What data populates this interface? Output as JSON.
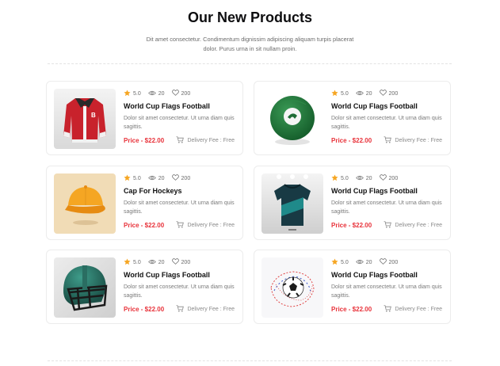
{
  "section": {
    "title": "Our New Products",
    "subtitle": "Dit amet consectetur. Condimentum dignissim adipiscing aliquam turpis placerat dolor. Purus urna in sit nullam proin."
  },
  "colors": {
    "price": "#e8323a",
    "star": "#f6a623",
    "title": "#0e0e10"
  },
  "products": [
    {
      "image": "varsity-jacket",
      "rating": "5.0",
      "views": "20",
      "likes": "200",
      "title": "World Cup Flags Football",
      "desc": "Dolor sit amet consectetur. Ut urna diam quis sagittis.",
      "price": "Price - $22.00",
      "delivery": "Delivery Fee : Free"
    },
    {
      "image": "green-ball",
      "rating": "5.0",
      "views": "20",
      "likes": "200",
      "title": "World Cup Flags Football",
      "desc": "Dolor sit amet consectetur. Ut urna diam quis sagittis.",
      "price": "Price - $22.00",
      "delivery": "Delivery Fee : Free"
    },
    {
      "image": "orange-cap",
      "rating": "5.0",
      "views": "20",
      "likes": "200",
      "title": "Cap For Hockeys",
      "desc": "Dolor sit amet consectetur. Ut urna diam quis sagittis.",
      "price": "Price - $22.00",
      "delivery": "Delivery Fee : Free"
    },
    {
      "image": "football-jersey",
      "rating": "5.0",
      "views": "20",
      "likes": "200",
      "title": "World Cup Flags Football",
      "desc": "Dolor sit amet consectetur. Ut urna diam quis sagittis.",
      "price": "Price - $22.00",
      "delivery": "Delivery Fee : Free"
    },
    {
      "image": "football-helmet",
      "rating": "5.0",
      "views": "20",
      "likes": "200",
      "title": "World Cup Flags Football",
      "desc": "Dolor sit amet consectetur. Ut urna diam quis sagittis.",
      "price": "Price - $22.00",
      "delivery": "Delivery Fee : Free"
    },
    {
      "image": "soccer-ball",
      "rating": "5.0",
      "views": "20",
      "likes": "200",
      "title": "World Cup Flags Football",
      "desc": "Dolor sit amet consectetur. Ut urna diam quis sagittis.",
      "price": "Price - $22.00",
      "delivery": "Delivery Fee : Free"
    }
  ]
}
